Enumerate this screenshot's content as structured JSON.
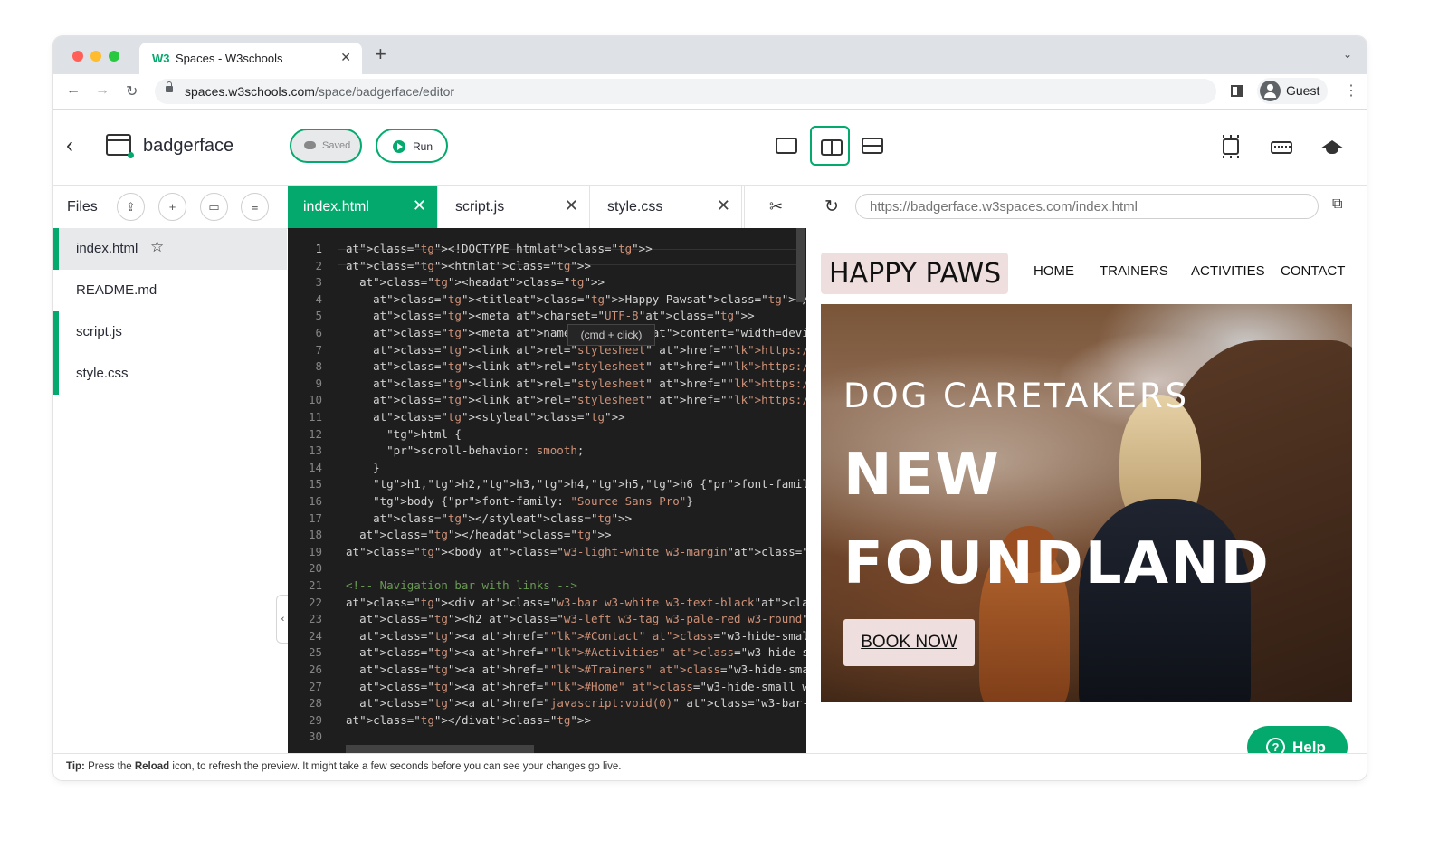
{
  "browser": {
    "tab_title": "Spaces - W3schools",
    "favicon": "W3",
    "url_host": "spaces.w3schools.com",
    "url_path": "/space/badgerface/editor",
    "profile_label": "Guest"
  },
  "app": {
    "project_name": "badgerface",
    "saved_label": "Saved",
    "run_label": "Run",
    "accent_color": "#04aa6d"
  },
  "files": {
    "title": "Files",
    "items": [
      {
        "name": "index.html",
        "active": true,
        "starred": true
      },
      {
        "name": "README.md",
        "active": false
      },
      {
        "name": "script.js",
        "active": false
      },
      {
        "name": "style.css",
        "active": false
      }
    ]
  },
  "editor": {
    "tabs": [
      {
        "label": "index.html",
        "active": true
      },
      {
        "label": "script.js",
        "active": false
      },
      {
        "label": "style.css",
        "active": false
      }
    ],
    "tooltip": "(cmd + click)",
    "line_numbers": [
      "1",
      "2",
      "3",
      "4",
      "5",
      "6",
      "7",
      "8",
      "9",
      "10",
      "11",
      "12",
      "13",
      "14",
      "15",
      "16",
      "17",
      "18",
      "19",
      "20",
      "21",
      "22",
      "23",
      "24",
      "25",
      "26",
      "27",
      "28",
      "29",
      "30"
    ],
    "lines": [
      "<!DOCTYPE html>",
      "<html>",
      "  <head>",
      "    <title>Happy Paws</title>",
      "    <meta charset=\"UTF-8\">",
      "    <meta name=\"viewport\" content=\"width=device-width, initial-scale",
      "    <link rel=\"stylesheet\" href=\"https://www.w3schools.com/w3css/4/w",
      "    <link rel=\"stylesheet\" href=\"https://fonts.googleapis.com/css?fa",
      "    <link rel=\"stylesheet\" href=\"https://fonts.googleapis.com/css?fa",
      "    <link rel=\"stylesheet\" href=\"https://cdnjs.cloudflare.com/ajax/l",
      "    <style>",
      "      html {",
      "      scroll-behavior: smooth;",
      "    }",
      "    h1,h2,h3,h4,h5,h6 {font-family: \"Roboto\"}",
      "    body {font-family: \"Source Sans Pro\"}",
      "    </style>",
      "  </head>",
      "<body class=\"w3-light-white w3-margin\">",
      "",
      "<!-- Navigation bar with links -->",
      "<div class=\"w3-bar w3-white w3-text-black\">",
      "  <h2 class=\"w3-left w3-tag w3-pale-red w3-round\">HAPPY PAWS</h2>",
      "  <a href=\"#Contact\" class=\"w3-hide-small w3-bar-item w3-button w3-m",
      "  <a href=\"#Activities\" class=\"w3-hide-small w3-bar-item w3-button w",
      "  <a href=\"#Trainers\" class=\"w3-hide-small w3-bar-item w3-button w3-",
      "  <a href=\"#Home\" class=\"w3-hide-small w3-bar-item w3-button w3-mobi",
      "  <a href=\"javascript:void(0)\" class=\"w3-bar-item w3-button w3-right",
      "</div>",
      ""
    ]
  },
  "preview": {
    "url": "https://badgerface.w3spaces.com/index.html",
    "logo": "HAPPY PAWS",
    "nav": [
      "HOME",
      "TRAINERS",
      "ACTIVITIES",
      "CONTACT"
    ],
    "hero_subtitle": "DOG CARETAKERS",
    "hero_title_line1": "NEW",
    "hero_title_line2": "FOUNDLAND",
    "cta": "BOOK NOW"
  },
  "help_label": "Help",
  "footer": {
    "tip_label": "Tip:",
    "tip_part1": "Press the",
    "tip_bold": "Reload",
    "tip_part2": "icon, to refresh the preview. It might take a few seconds before you can see your changes go live."
  }
}
